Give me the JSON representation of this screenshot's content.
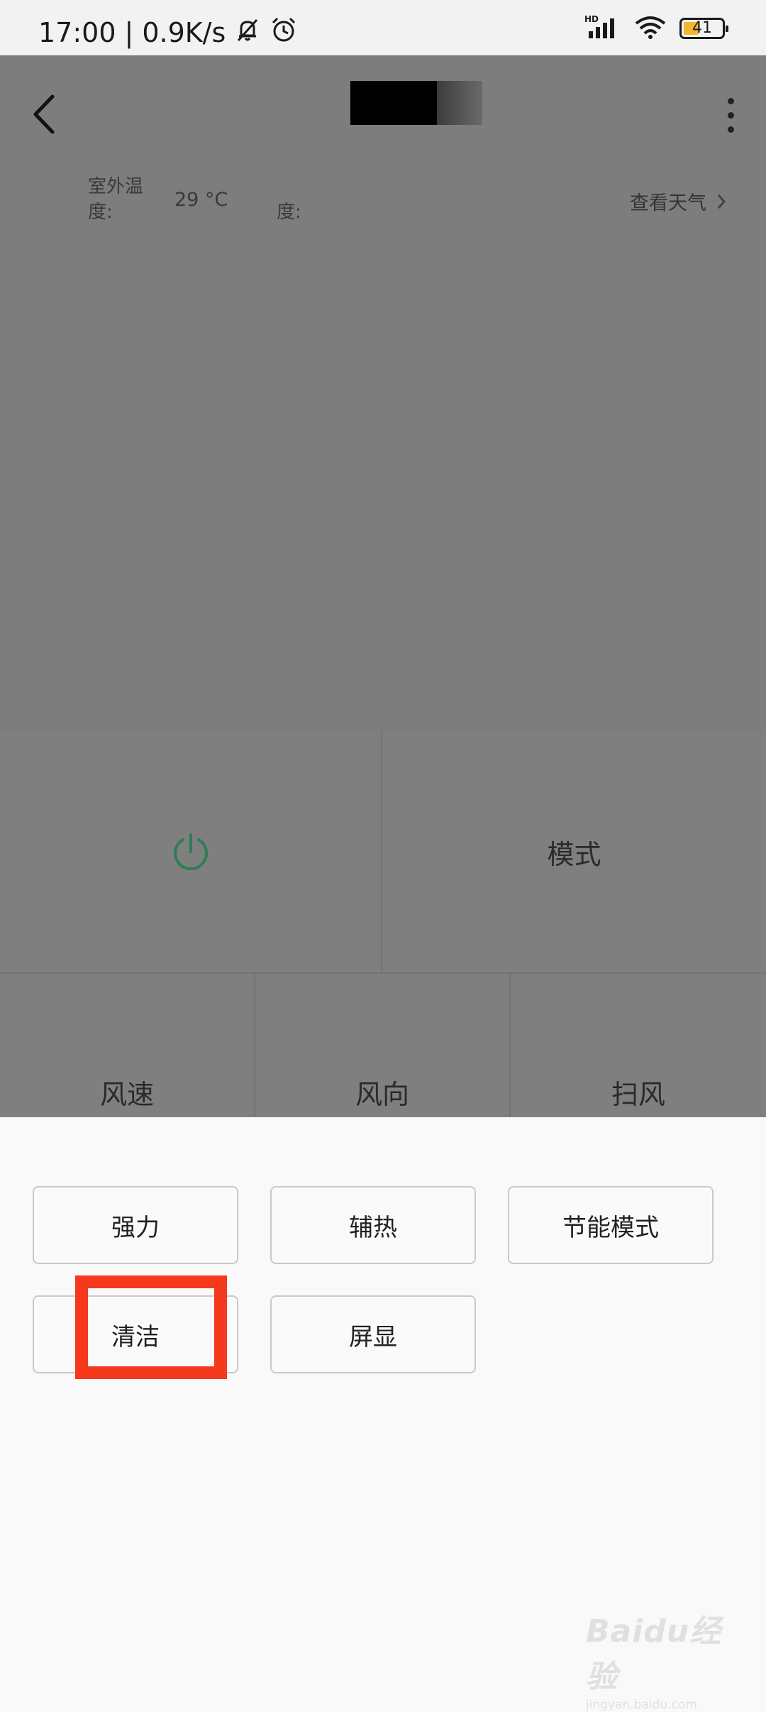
{
  "status_bar": {
    "time": "17:00",
    "separator": "|",
    "network_speed": "0.9K/s",
    "signal_label": "HD",
    "battery_level": "41",
    "battery_fraction": 0.41
  },
  "header": {
    "title_redacted": true
  },
  "weather": {
    "outdoor_temp_label_line1": "室外温",
    "outdoor_temp_label_line2": "度:",
    "outdoor_temp_value": "29 °C",
    "second_label": "度:",
    "view_weather_link": "查看天气"
  },
  "controls": {
    "mode_label": "模式",
    "fan_speed_label": "风速",
    "fan_direction_label": "风向",
    "swing_label": "扫风"
  },
  "options": {
    "buttons": [
      "强力",
      "辅热",
      "节能模式",
      "清洁",
      "屏显"
    ]
  },
  "colors": {
    "power_icon": "#2f7d55",
    "highlight": "#f5391c",
    "battery_fill": "#f3b72c"
  },
  "watermark": {
    "brand": "Baidu经验",
    "url": "jingyan.baidu.com"
  }
}
